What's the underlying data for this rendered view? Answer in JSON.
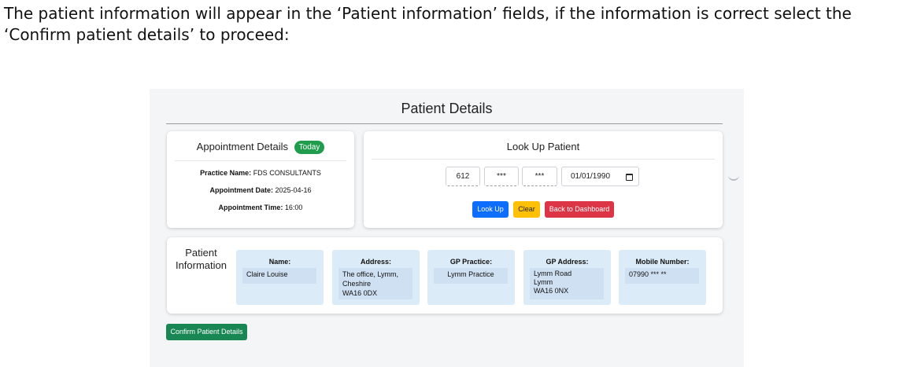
{
  "instruction": "The patient information will appear in the ‘Patient information’ fields, if the information is correct select the ‘Confirm patient details’ to proceed:",
  "page": {
    "title": "Patient Details"
  },
  "appointment": {
    "heading": "Appointment Details",
    "badge": "Today",
    "practice_label": "Practice Name:",
    "practice_value": "FDS CONSULTANTS",
    "date_label": "Appointment Date:",
    "date_value": "2025-04-16",
    "time_label": "Appointment Time:",
    "time_value": "16:00"
  },
  "lookup": {
    "heading": "Look Up Patient",
    "field1": "612",
    "field2": "***",
    "field3": "***",
    "dob": "01/01/1990",
    "lookup_button": "Look Up",
    "clear_button": "Clear",
    "dashboard_button": "Back to Dashboard"
  },
  "patient": {
    "label": "Patient Information",
    "name_label": "Name:",
    "name_value": "Claire Louise",
    "address_label": "Address:",
    "address_value": "The office, Lymm, Cheshire\nWA16 0DX",
    "gp_practice_label": "GP Practice:",
    "gp_practice_value": "Lymm Practice",
    "gp_address_label": "GP Address:",
    "gp_address_value": "Lymm Road\nLymm\nWA16 0NX",
    "mobile_label": "Mobile Number:",
    "mobile_value": "07990 *** **"
  },
  "confirm_button": "Confirm Patient Details",
  "colors": {
    "badge": "#1f9d4c",
    "lookup": "#0d6efd",
    "clear": "#ffc107",
    "dashboard": "#dc3545",
    "confirm": "#198754",
    "info_box": "#dcebf8"
  },
  "icons": {
    "date": "calendar-icon"
  }
}
